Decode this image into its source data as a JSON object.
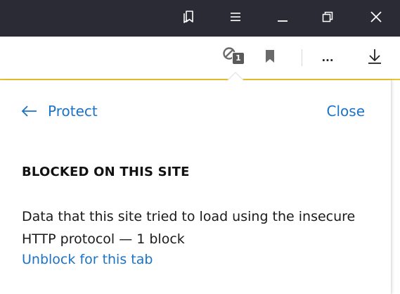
{
  "window": {
    "controls": [
      {
        "name": "bookmarks-collection-icon"
      },
      {
        "name": "menu-icon"
      },
      {
        "name": "minimize-icon"
      },
      {
        "name": "restore-icon"
      },
      {
        "name": "close-window-icon"
      }
    ]
  },
  "toolbar": {
    "protect_badge_count": "1",
    "more_label": "..."
  },
  "panel": {
    "back_label": "Protect",
    "close_label": "Close",
    "heading": "BLOCKED ON THIS SITE",
    "description": "Data that this site tried to load using the insecure HTTP protocol — 1 block",
    "unblock_label": "Unblock for this tab"
  },
  "colors": {
    "titlebar": "#2b2b35",
    "accent_link": "#1a73c7",
    "toolbar_border": "#e8c52c"
  }
}
